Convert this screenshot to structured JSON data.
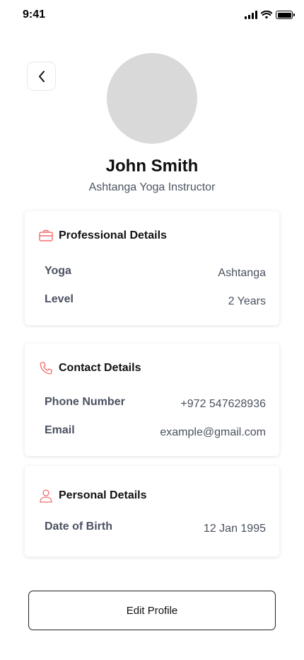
{
  "status_bar": {
    "time": "9:41"
  },
  "profile": {
    "name": "John Smith",
    "role": "Ashtanga Yoga Instructor"
  },
  "professional": {
    "title": "Professional Details",
    "icon": "briefcase-icon",
    "rows": [
      {
        "label": "Yoga",
        "value": "Ashtanga"
      },
      {
        "label": "Level",
        "value": "2 Years"
      }
    ]
  },
  "contact": {
    "title": "Contact Details",
    "icon": "phone-icon",
    "rows": [
      {
        "label": "Phone Number",
        "value": "+972 547628936"
      },
      {
        "label": "Email",
        "value": "example@gmail.com"
      }
    ]
  },
  "personal": {
    "title": "Personal Details",
    "icon": "user-icon",
    "rows": [
      {
        "label": "Date of Birth",
        "value": "12 Jan 1995"
      }
    ]
  },
  "actions": {
    "edit_label": "Edit Profile"
  },
  "colors": {
    "accent_icon": "#f26d6d",
    "label_text": "#4a5160"
  }
}
